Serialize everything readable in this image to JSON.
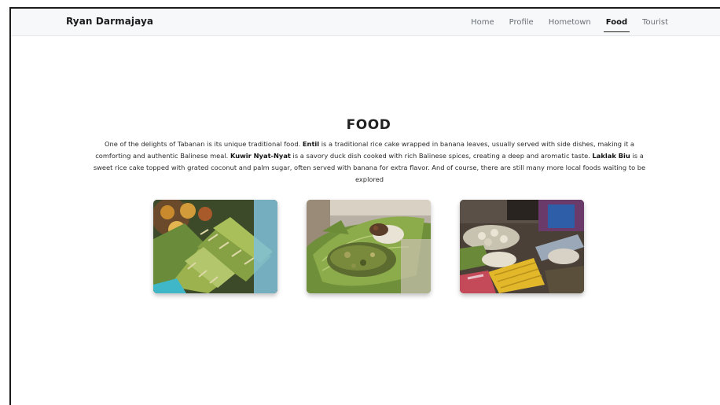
{
  "navbar": {
    "brand": "Ryan Darmajaya",
    "links": [
      {
        "label": "Home",
        "active": false
      },
      {
        "label": "Profile",
        "active": false
      },
      {
        "label": "Hometown",
        "active": false
      },
      {
        "label": "Food",
        "active": true
      },
      {
        "label": "Tourist",
        "active": false
      }
    ]
  },
  "section": {
    "title": "FOOD",
    "intro": {
      "p1": "One of the delights of Tabanan is its unique traditional food. ",
      "b1": "Entil",
      "p2": " is a traditional rice cake wrapped in banana leaves, usually served with side dishes, making it a comforting and authentic Balinese meal. ",
      "b2": "Kuwir Nyat-Nyat",
      "p3": " is a savory duck dish cooked with rich Balinese spices, creating a deep and aromatic taste. ",
      "b3": "Laklak Biu",
      "p4": " is a sweet rice cake topped with grated coconut and palm sugar, often served with banana for extra flavor. And of course, there are still many more local foods waiting to be explored"
    }
  },
  "gallery": {
    "images": [
      {
        "subject": "entil-photo"
      },
      {
        "subject": "kuwir-nyat-nyat-photo"
      },
      {
        "subject": "laklak-biu-photo"
      }
    ]
  },
  "colors": {
    "navbar_bg": "#f7f8fa",
    "text": "#222222",
    "nav_muted": "#6a6f76"
  }
}
